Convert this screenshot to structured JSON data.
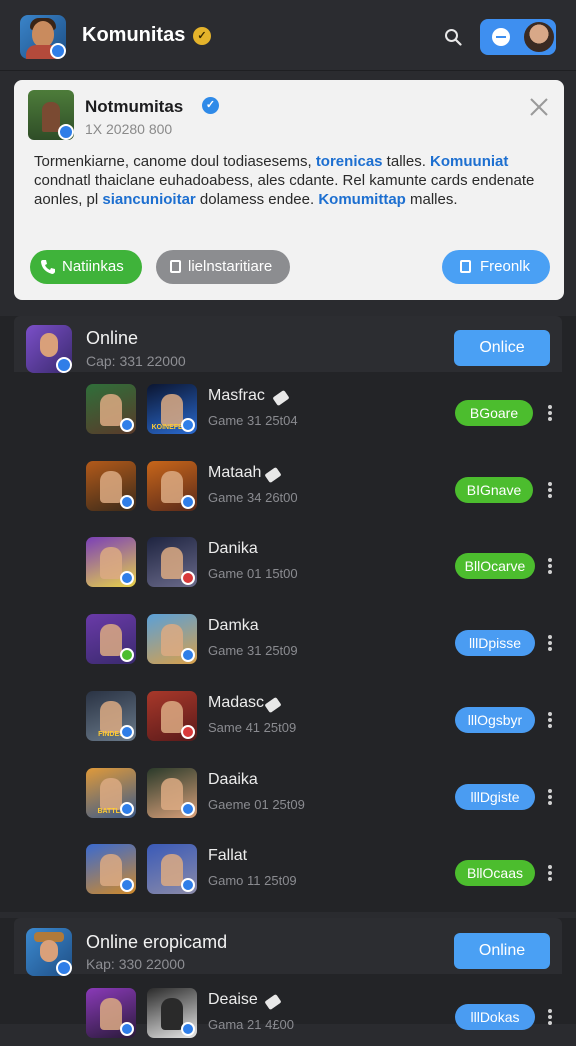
{
  "header": {
    "title": "Komunitas",
    "accent": "#3e8ff0"
  },
  "notice": {
    "title": "Notmumitas",
    "meta": "1X 20280 800",
    "body": {
      "part1": "Tormenkiarne, canome doul todiasesems, ",
      "link1": "torenicas",
      "part2": " talles. ",
      "link2": "Komuuniat",
      "part3": " condnatl thaiclane euhadoabess, ales cdante. Rel kamunte cards endenate aonles, pl ",
      "link3": "siancunioitar",
      "part4": " dolamess endee. ",
      "link4": "Komumittap",
      "part5": " malles."
    },
    "buttons": {
      "green": "Natiinkas",
      "gray": "lielnstaritiare",
      "blue": "Freonlk"
    }
  },
  "section1": {
    "title": "Online",
    "subtitle": "Cap: 331 22000",
    "button": "Onlice"
  },
  "section2": {
    "title": "Online eropicamd",
    "subtitle": "Kap: 330 22000",
    "button": "Online"
  },
  "rows": [
    {
      "title": "Masfrac",
      "sub": "Game 31 25t04",
      "pill": "BGoare",
      "pill_color": "green",
      "tag": true,
      "icon2_text": "KOINEFERS"
    },
    {
      "title": "Mataah",
      "sub": "Game 34 26t00",
      "pill": "BIGnave",
      "pill_color": "green",
      "tag": true
    },
    {
      "title": "Danika",
      "sub": "Game 01 15t00",
      "pill": "BllOcarve",
      "pill_color": "green",
      "tag": false
    },
    {
      "title": "Damka",
      "sub": "Game 31 25t09",
      "pill": "lllDpisse",
      "pill_color": "blue",
      "tag": false
    },
    {
      "title": "Madasc",
      "sub": "Same 41 25t09",
      "pill": "lllOgsbyr",
      "pill_color": "blue",
      "tag": true,
      "icon1_text": "FINDES"
    },
    {
      "title": "Daaika",
      "sub": "Gaeme 01 25t09",
      "pill": "lllDgiste",
      "pill_color": "blue",
      "tag": false,
      "icon1_text": "BATTLE"
    },
    {
      "title": "Fallat",
      "sub": "Gamo 11 25t09",
      "pill": "BllOcaas",
      "pill_color": "green",
      "tag": false
    },
    {
      "title": "Deaise",
      "sub": "Gama 21 4£00",
      "pill": "lllDokas",
      "pill_color": "blue",
      "tag": true
    }
  ]
}
